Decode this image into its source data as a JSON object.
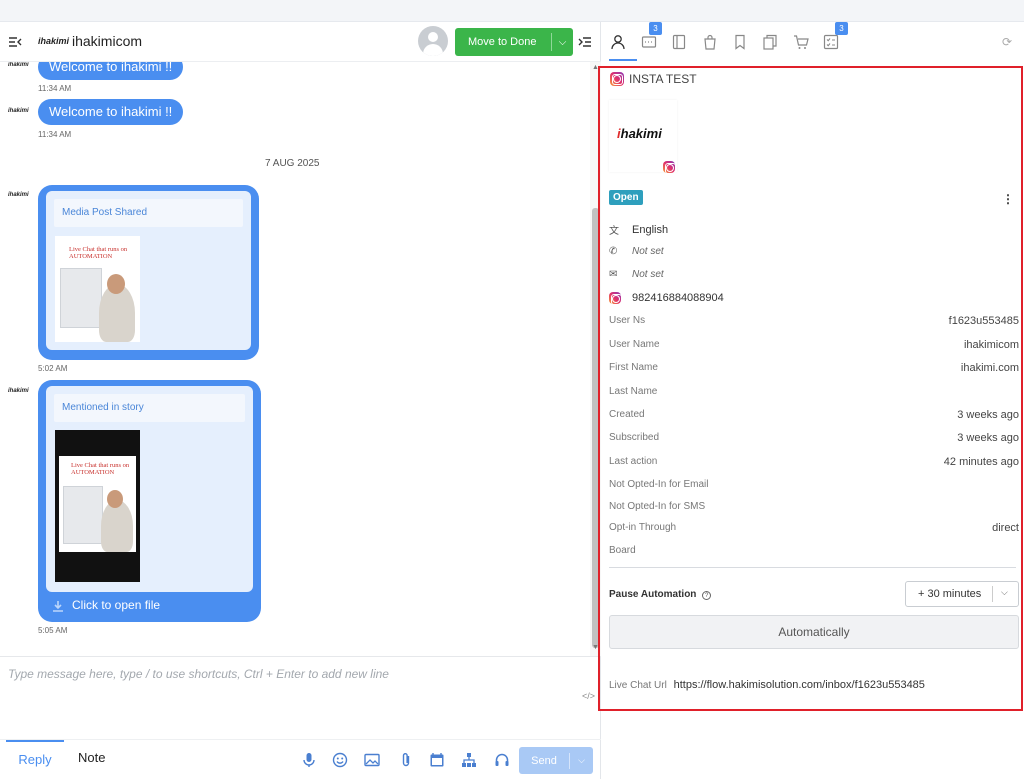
{
  "header": {
    "brand": "ihakimi",
    "contact_name": "ihakimicom",
    "done_button": "Move to Done",
    "done_arrow": "⌵"
  },
  "messages": {
    "welcome_1": "Welcome to ihakimi !!",
    "time_1": "11:34 AM",
    "welcome_2": "Welcome to ihakimi !!",
    "time_2": "11:34 AM",
    "date": "7 AUG 2025",
    "card1": {
      "title": "Media Post Shared",
      "img_title": "Live Chat that runs on AUTOMATION",
      "time": "5:02 AM"
    },
    "card2": {
      "title": "Mentioned in story",
      "img_title": "Live Chat that runs on AUTOMATION",
      "open_file": "Click to open file",
      "time": "5:05 AM"
    }
  },
  "composer": {
    "placeholder": "Type message here, type / to use shortcuts, Ctrl + Enter to add new line",
    "code": "</>",
    "tab_reply": "Reply",
    "tab_note": "Note",
    "send": "Send",
    "send_arrow": "⌵",
    "tools": [
      "microphone-icon",
      "emoji-icon",
      "image-icon",
      "attachment-icon",
      "calendar-icon",
      "flow-icon",
      "headset-icon"
    ]
  },
  "sidebar": {
    "tab_badges": {
      "notes": "3",
      "tasks": "3"
    },
    "refresh": "⟳",
    "channel_title": "INSTA TEST",
    "profile_brand_i": "i",
    "profile_brand_rest": "hakimi",
    "status": "Open",
    "kebab": "⋮",
    "language": "English",
    "phone": "Not set",
    "email": "Not set",
    "instagram_id": "982416884088904",
    "fields": [
      {
        "key": "User Ns",
        "value": "f1623u553485"
      },
      {
        "key": "User Name",
        "value": "ihakimicom"
      },
      {
        "key": "First Name",
        "value": "ihakimi.com"
      },
      {
        "key": "Last Name",
        "value": ""
      },
      {
        "key": "Created",
        "value": "3 weeks ago"
      },
      {
        "key": "Subscribed",
        "value": "3 weeks ago"
      },
      {
        "key": "Last action",
        "value": "42 minutes ago"
      },
      {
        "key": "Not Opted-In for Email",
        "value": ""
      },
      {
        "key": "Not Opted-In for SMS",
        "value": ""
      },
      {
        "key": "Opt-in Through",
        "value": "direct"
      },
      {
        "key": "Board",
        "value": ""
      }
    ],
    "pause_label": "Pause Automation",
    "pause_help": "?",
    "pause_value": "+ 30 minutes",
    "pause_arrow": "⌵",
    "auto_button": "Automatically",
    "live_chat_label": "Live Chat Url",
    "live_chat_url": "https://flow.hakimisolution.com/inbox/f1623u553485"
  },
  "colors": {
    "accent": "#4a8ef0",
    "done": "#3bb54a",
    "status": "#2e9fbd",
    "highlight": "#e0202a"
  }
}
